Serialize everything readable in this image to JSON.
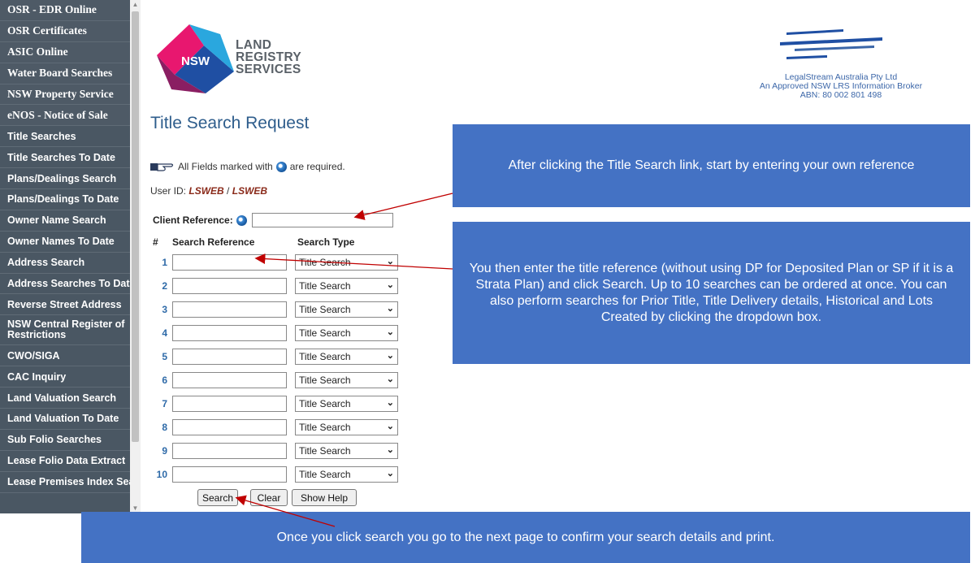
{
  "sidebar": {
    "items": [
      {
        "label": "OSR - EDR Online",
        "style": "top"
      },
      {
        "label": "OSR Certificates",
        "style": "top"
      },
      {
        "label": "ASIC Online",
        "style": "top"
      },
      {
        "label": "Water Board Searches",
        "style": "top"
      },
      {
        "label": "NSW Property Service",
        "style": "top"
      },
      {
        "label": "eNOS - Notice of Sale",
        "style": "top"
      },
      {
        "label": "Title Searches"
      },
      {
        "label": "Title Searches To Date"
      },
      {
        "label": "Plans/Dealings Search"
      },
      {
        "label": "Plans/Dealings To Date"
      },
      {
        "label": "Owner Name Search"
      },
      {
        "label": "Owner Names To Date"
      },
      {
        "label": "Address Search"
      },
      {
        "label": "Address Searches To Date"
      },
      {
        "label": "Reverse Street Address"
      },
      {
        "label": "NSW Central Register of Restrictions"
      },
      {
        "label": "CWO/SIGA"
      },
      {
        "label": "CAC Inquiry"
      },
      {
        "label": "Land Valuation Search"
      },
      {
        "label": "Land Valuation To Date"
      },
      {
        "label": "Sub Folio Searches"
      },
      {
        "label": "Lease Folio Data Extract"
      },
      {
        "label": "Lease Premises Index Search"
      }
    ]
  },
  "logos": {
    "nsw_badge": "NSW",
    "lrs_line1": "LAND",
    "lrs_line2": "REGISTRY",
    "lrs_line3": "SERVICES",
    "broker_line1": "LegalStream Australia Pty Ltd",
    "broker_line2": "An Approved NSW LRS Information Broker",
    "broker_line3": "ABN: 80 002 801 498"
  },
  "form": {
    "title": "Title Search Request",
    "required_prefix": "All Fields marked with",
    "required_suffix": "are required.",
    "user_label": "User ID:",
    "user_id_1": "LSWEB",
    "user_sep": "/",
    "user_id_2": "LSWEB",
    "client_ref_label": "Client Reference:",
    "client_ref_value": "",
    "col_hash": "#",
    "col_ref": "Search Reference",
    "col_type": "Search Type",
    "rows": [
      {
        "num": "1",
        "ref": "",
        "type": "Title Search"
      },
      {
        "num": "2",
        "ref": "",
        "type": "Title Search"
      },
      {
        "num": "3",
        "ref": "",
        "type": "Title Search"
      },
      {
        "num": "4",
        "ref": "",
        "type": "Title Search"
      },
      {
        "num": "5",
        "ref": "",
        "type": "Title Search"
      },
      {
        "num": "6",
        "ref": "",
        "type": "Title Search"
      },
      {
        "num": "7",
        "ref": "",
        "type": "Title Search"
      },
      {
        "num": "8",
        "ref": "",
        "type": "Title Search"
      },
      {
        "num": "9",
        "ref": "",
        "type": "Title Search"
      },
      {
        "num": "10",
        "ref": "",
        "type": "Title Search"
      }
    ],
    "search_button": "Search",
    "clear_button": "Clear",
    "help_button": "Show Help"
  },
  "callouts": {
    "c1": "After clicking the Title Search link, start by entering your own reference",
    "c2": "You then enter the title reference (without using DP for Deposited Plan or SP if it is a Strata Plan) and click Search. Up to 10 searches can be ordered at once. You can also perform searches for Prior Title, Title Delivery details, Historical and Lots Created by clicking the dropdown box.",
    "c3": "Once you click search you go to the next page to confirm your search details and print."
  },
  "colors": {
    "sidebar_bg": "#4a5763",
    "callout_bg": "#4472c4",
    "arrow": "#c00000",
    "title": "#2e5d8c"
  }
}
